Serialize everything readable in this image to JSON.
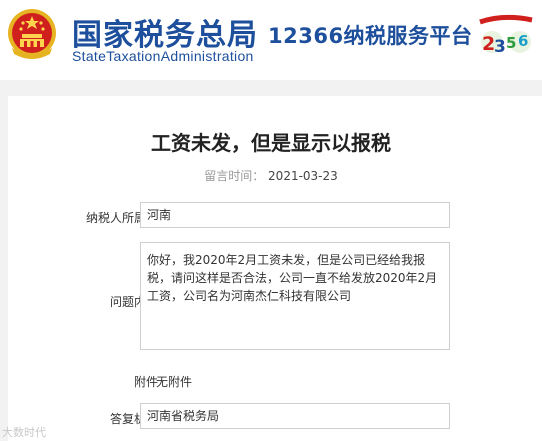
{
  "header": {
    "logo_cn": "国家税务总局",
    "logo_en": "StateTaxationAdministration",
    "platform_title": "12366纳税服务平台",
    "badge_number": "2356"
  },
  "article": {
    "title": "工资未发，但是显示以报税",
    "time_label": "留言时间：",
    "time_value": "2021-03-23"
  },
  "form": {
    "location_label": "纳税人所属地",
    "location_value": "河南",
    "question_label": "问题内容",
    "question_value": "你好，我2020年2月工资未发，但是公司已经给我报税，请问这样是否合法，公司一直不给发放2020年2月工资，公司名为河南杰仁科技有限公司",
    "attachment_label": "附件",
    "attachment_value": "无附件",
    "agency_label": "答复机构",
    "agency_value": "河南省税务局"
  },
  "watermark": "大数时代",
  "colors": {
    "brand_blue": "#1d4f9c",
    "emblem_red": "#d0201d",
    "emblem_gold": "#e6b422"
  }
}
